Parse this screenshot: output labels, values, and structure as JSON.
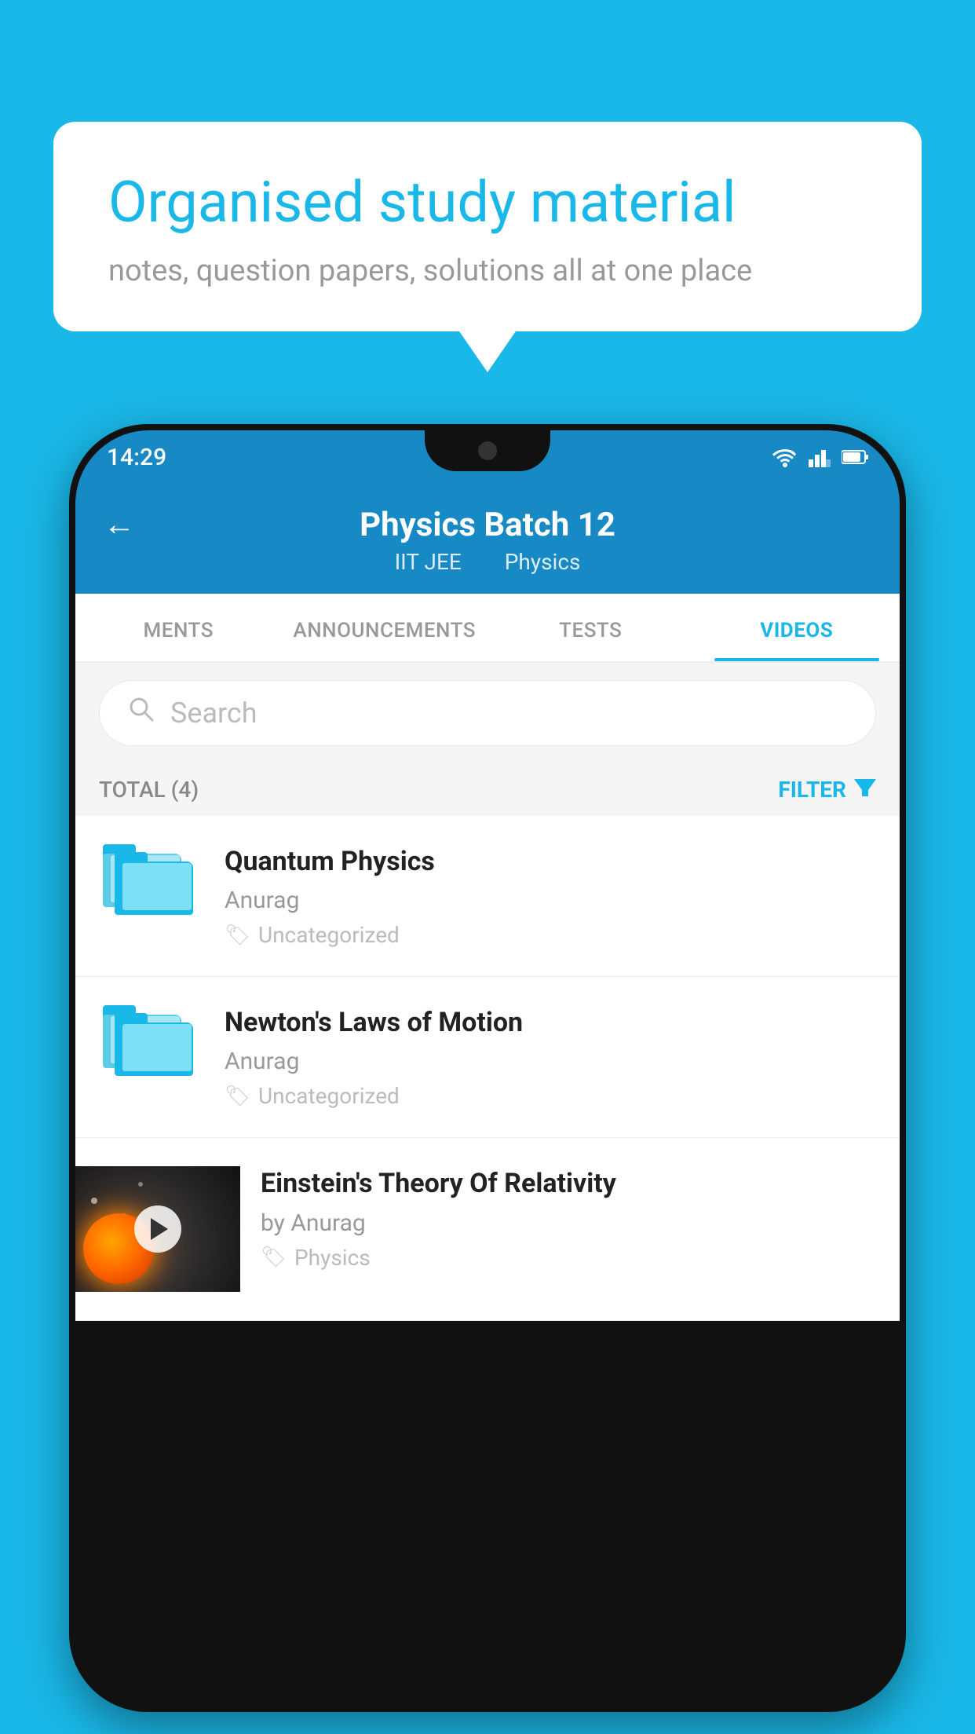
{
  "background_color": "#1ab8e8",
  "bubble": {
    "title": "Organised study material",
    "subtitle": "notes, question papers, solutions all at one place"
  },
  "phone": {
    "status_bar": {
      "time": "14:29"
    },
    "header": {
      "title": "Physics Batch 12",
      "subtitle1": "IIT JEE",
      "subtitle2": "Physics",
      "back_label": "←"
    },
    "tabs": [
      {
        "label": "MENTS",
        "active": false
      },
      {
        "label": "ANNOUNCEMENTS",
        "active": false
      },
      {
        "label": "TESTS",
        "active": false
      },
      {
        "label": "VIDEOS",
        "active": true
      }
    ],
    "search": {
      "placeholder": "Search"
    },
    "filter": {
      "total_label": "TOTAL (4)",
      "filter_label": "FILTER"
    },
    "videos": [
      {
        "id": 1,
        "title": "Quantum Physics",
        "author": "Anurag",
        "tag": "Uncategorized",
        "has_thumb": false
      },
      {
        "id": 2,
        "title": "Newton's Laws of Motion",
        "author": "Anurag",
        "tag": "Uncategorized",
        "has_thumb": false
      },
      {
        "id": 3,
        "title": "Einstein's Theory Of Relativity",
        "author": "by Anurag",
        "tag": "Physics",
        "has_thumb": true
      }
    ]
  }
}
